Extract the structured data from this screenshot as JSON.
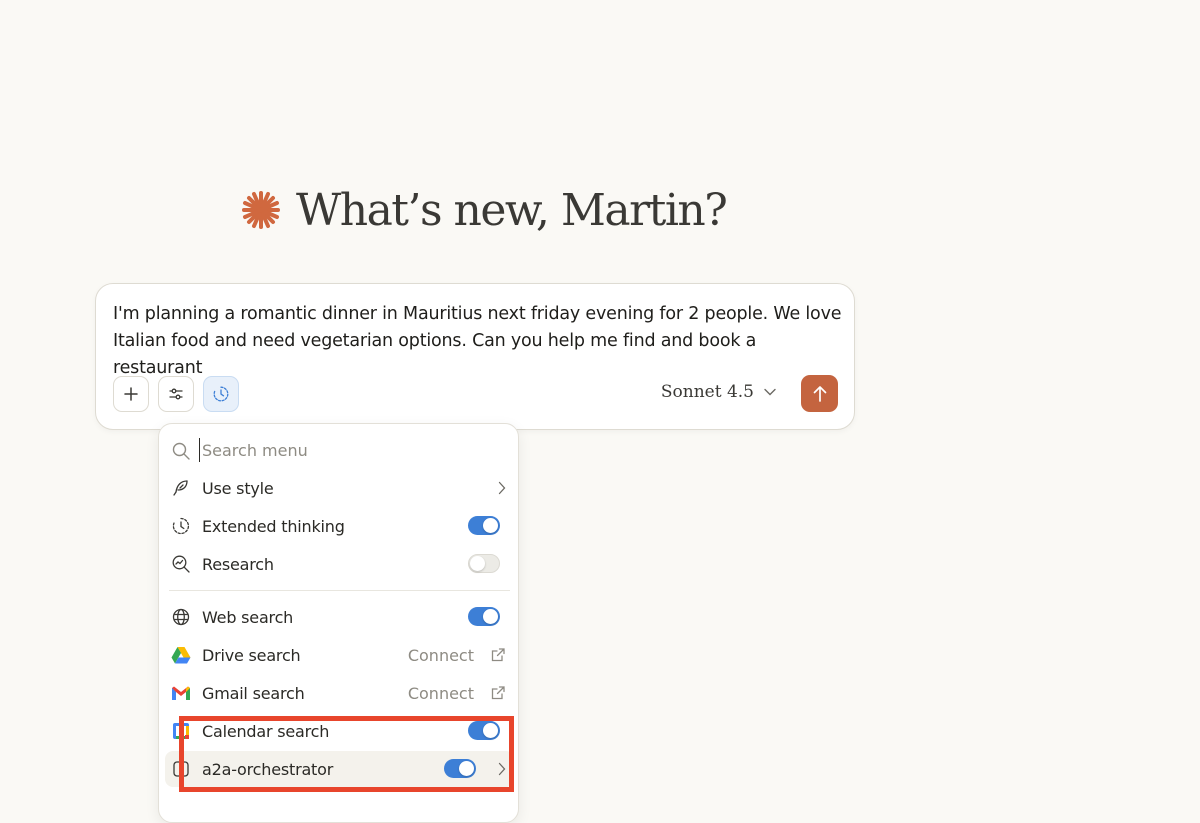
{
  "greeting": {
    "text": "What’s new, Martin?"
  },
  "composer": {
    "prompt": "I'm planning a romantic dinner in Mauritius next friday evening for 2 people. We love Italian food and need vegetarian options. Can you help me find and book a restaurant",
    "model": "Sonnet 4.5"
  },
  "menu": {
    "search_placeholder": "Search menu",
    "items": [
      {
        "label": "Use style",
        "icon": "feather-icon",
        "control": "chevron"
      },
      {
        "label": "Extended thinking",
        "icon": "clock-icon",
        "control": "toggle",
        "on": true
      },
      {
        "label": "Research",
        "icon": "research-icon",
        "control": "toggle",
        "on": false
      },
      {
        "label": "Web search",
        "icon": "globe-icon",
        "control": "toggle",
        "on": true
      },
      {
        "label": "Drive search",
        "icon": "google-drive-icon",
        "control": "connect",
        "connect_label": "Connect"
      },
      {
        "label": "Gmail search",
        "icon": "gmail-icon",
        "control": "connect",
        "connect_label": "Connect"
      },
      {
        "label": "Calendar search",
        "icon": "google-calendar-icon",
        "control": "toggle",
        "on": true
      },
      {
        "label": "a2a-orchestrator",
        "icon": "connector-icon",
        "control": "toggle-chevron",
        "on": true
      }
    ]
  },
  "colors": {
    "background": "#faf9f5",
    "accent_orange": "#c4643f",
    "toggle_on": "#3d7fd6",
    "highlight_red": "#e8452c"
  }
}
